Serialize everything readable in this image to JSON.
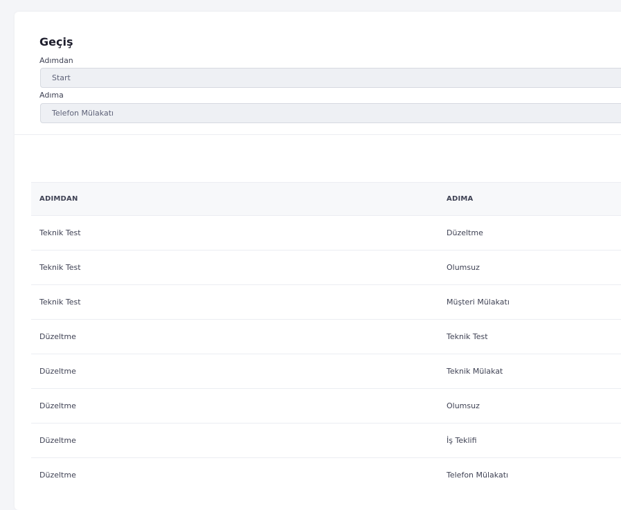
{
  "form": {
    "title": "Geçiş",
    "from_label": "Adımdan",
    "from_value": "Start",
    "to_label": "Adıma",
    "to_value": "Telefon Mülakatı"
  },
  "table": {
    "headers": [
      "ADIMDAN",
      "ADIMA"
    ],
    "rows": [
      {
        "from": "Teknik Test",
        "to": "Düzeltme"
      },
      {
        "from": "Teknik Test",
        "to": "Olumsuz"
      },
      {
        "from": "Teknik Test",
        "to": "Müşteri Mülakatı"
      },
      {
        "from": "Düzeltme",
        "to": "Teknik Test"
      },
      {
        "from": "Düzeltme",
        "to": "Teknik Mülakat"
      },
      {
        "from": "Düzeltme",
        "to": "Olumsuz"
      },
      {
        "from": "Düzeltme",
        "to": "İş Teklifi"
      },
      {
        "from": "Düzeltme",
        "to": "Telefon Mülakatı"
      }
    ]
  }
}
